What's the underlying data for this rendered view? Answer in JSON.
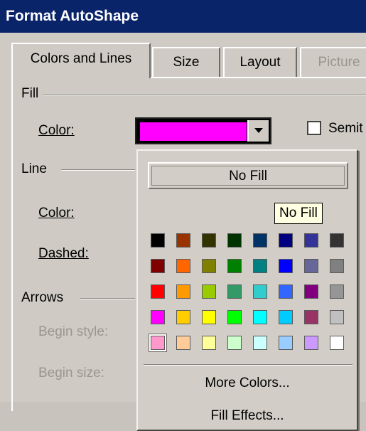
{
  "window": {
    "title": "Format AutoShape"
  },
  "tabs": [
    {
      "label": "Colors and Lines",
      "active": true,
      "enabled": true
    },
    {
      "label": "Size",
      "active": false,
      "enabled": true
    },
    {
      "label": "Layout",
      "active": false,
      "enabled": true
    },
    {
      "label": "Picture",
      "active": false,
      "enabled": false
    }
  ],
  "fill": {
    "group_label": "Fill",
    "color_label": "Color:",
    "current_color": "#ff00ff",
    "semi_label": "Semit"
  },
  "line": {
    "group_label": "Line",
    "color_label": "Color:",
    "dashed_label": "Dashed:"
  },
  "arrows": {
    "group_label": "Arrows",
    "begin_style_label": "Begin style:",
    "begin_size_label": "Begin size:"
  },
  "color_popup": {
    "no_fill_label": "No Fill",
    "tooltip": "No Fill",
    "more_colors_label": "More Colors...",
    "fill_effects_label": "Fill Effects...",
    "selected_index": 32,
    "palette": [
      "#000000",
      "#993300",
      "#333300",
      "#003300",
      "#003366",
      "#000080",
      "#333399",
      "#333333",
      "#800000",
      "#ff6600",
      "#808000",
      "#008000",
      "#008080",
      "#0000ff",
      "#666699",
      "#808080",
      "#ff0000",
      "#ff9900",
      "#99cc00",
      "#339966",
      "#33cccc",
      "#3366ff",
      "#800080",
      "#969696",
      "#ff00ff",
      "#ffcc00",
      "#ffff00",
      "#00ff00",
      "#00ffff",
      "#00ccff",
      "#993366",
      "#c0c0c0",
      "#ff99cc",
      "#ffcc99",
      "#ffff99",
      "#ccffcc",
      "#ccffff",
      "#99ccff",
      "#cc99ff",
      "#ffffff"
    ]
  }
}
